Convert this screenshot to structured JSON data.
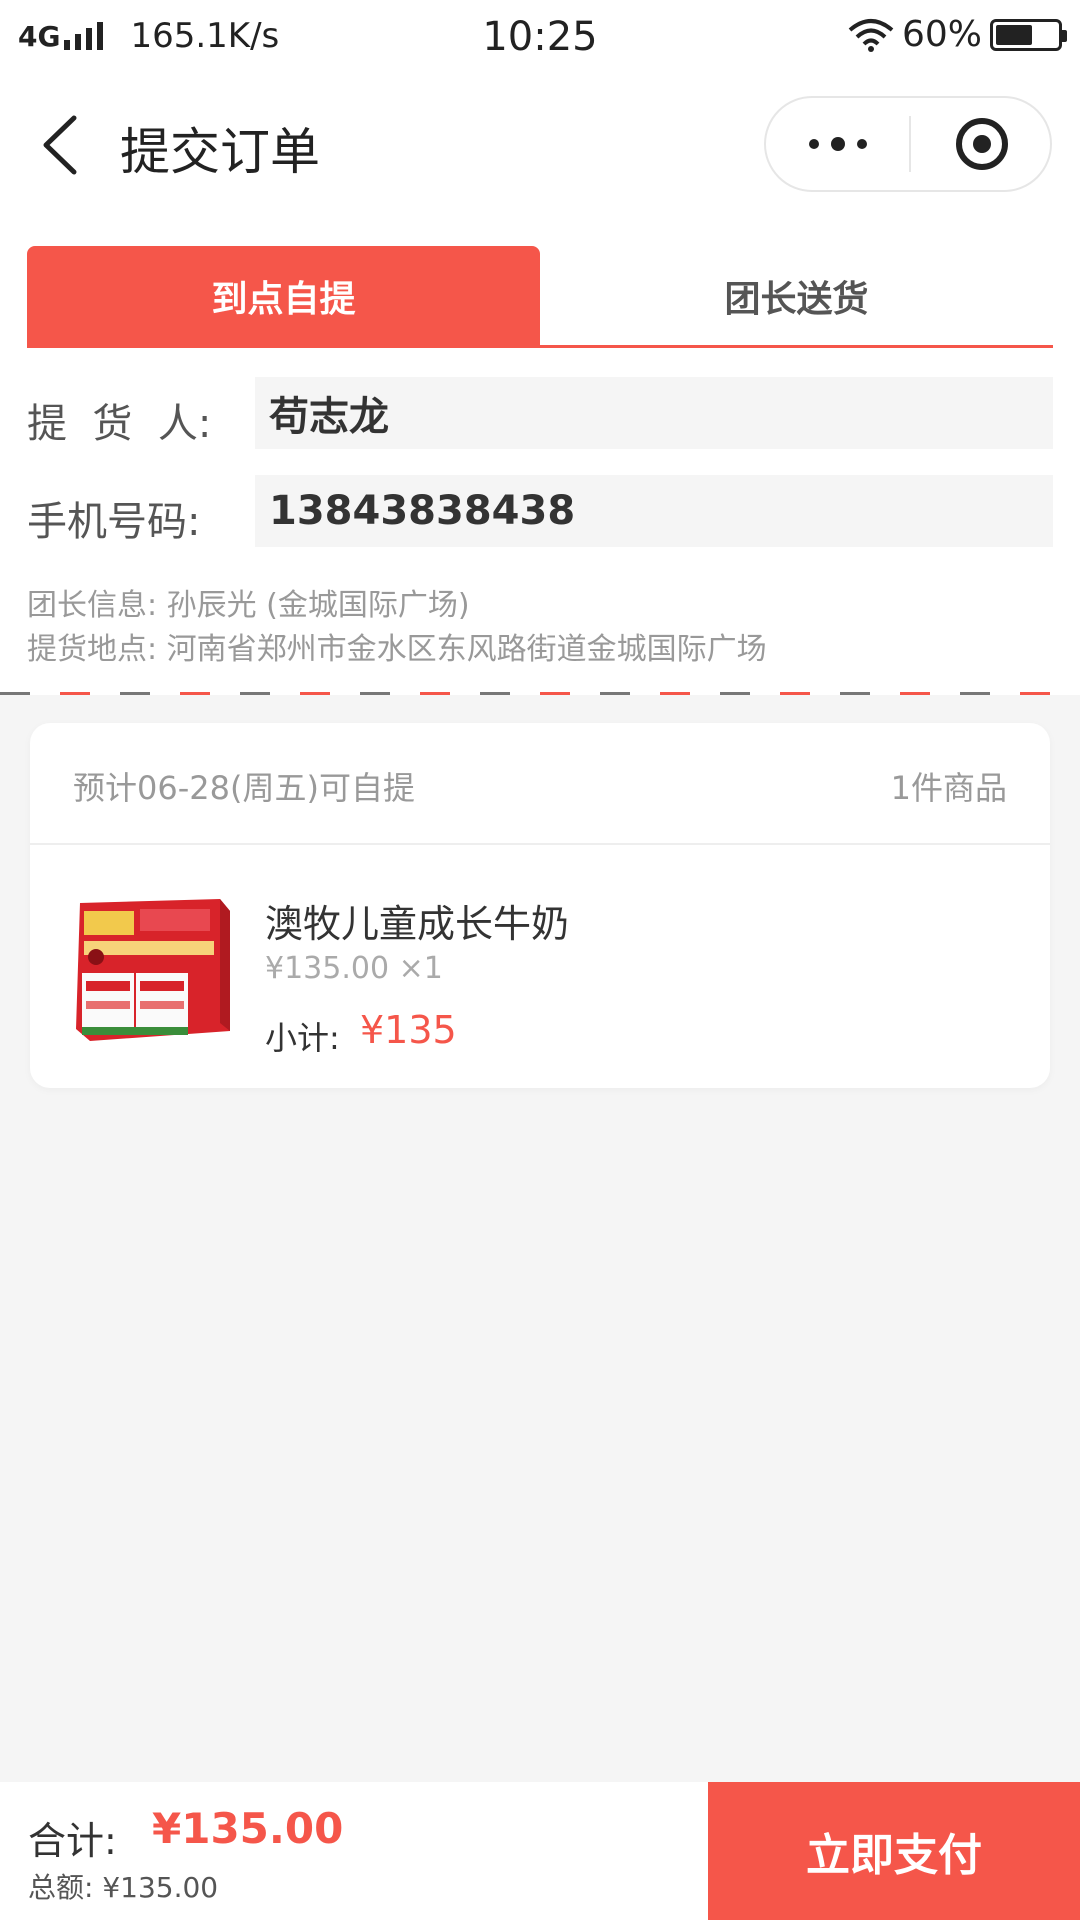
{
  "status_bar": {
    "network": "4G",
    "speed": "165.1K/s",
    "time": "10:25",
    "battery": "60%",
    "battery_level": 0.6,
    "icons": [
      "signal-icon",
      "wifi-icon",
      "battery-icon"
    ]
  },
  "nav": {
    "title": "提交订单",
    "icons": [
      "back-chevron-icon",
      "more-dots-icon",
      "target-close-icon"
    ]
  },
  "tabs": [
    {
      "label": "到点自提",
      "active": true
    },
    {
      "label": "团长送货",
      "active": false
    }
  ],
  "form": {
    "pickup_person_label": "提  货  人:",
    "pickup_person_value": "苟志龙",
    "phone_label": "手机号码:",
    "phone_value": "13843838438",
    "leader_info": "团长信息: 孙辰光 (金城国际广场)",
    "pickup_address": "提货地点: 河南省郑州市金水区东风路街道金城国际广场"
  },
  "order": {
    "pickup_date": "预计06-28(周五)可自提",
    "item_count": "1件商品",
    "items": [
      {
        "name": "澳牧儿童成长牛奶",
        "price_qty": "¥135.00 ×1",
        "subtotal_label": "小计:",
        "subtotal": "¥135"
      }
    ]
  },
  "bottom": {
    "total_label": "合计:",
    "total_value": "¥135.00",
    "amount": "总额: ¥135.00",
    "pay_label": "立即支付"
  },
  "colors": {
    "accent": "#f5564a",
    "background": "#f5f5f5",
    "dash_gray": "#777777"
  }
}
